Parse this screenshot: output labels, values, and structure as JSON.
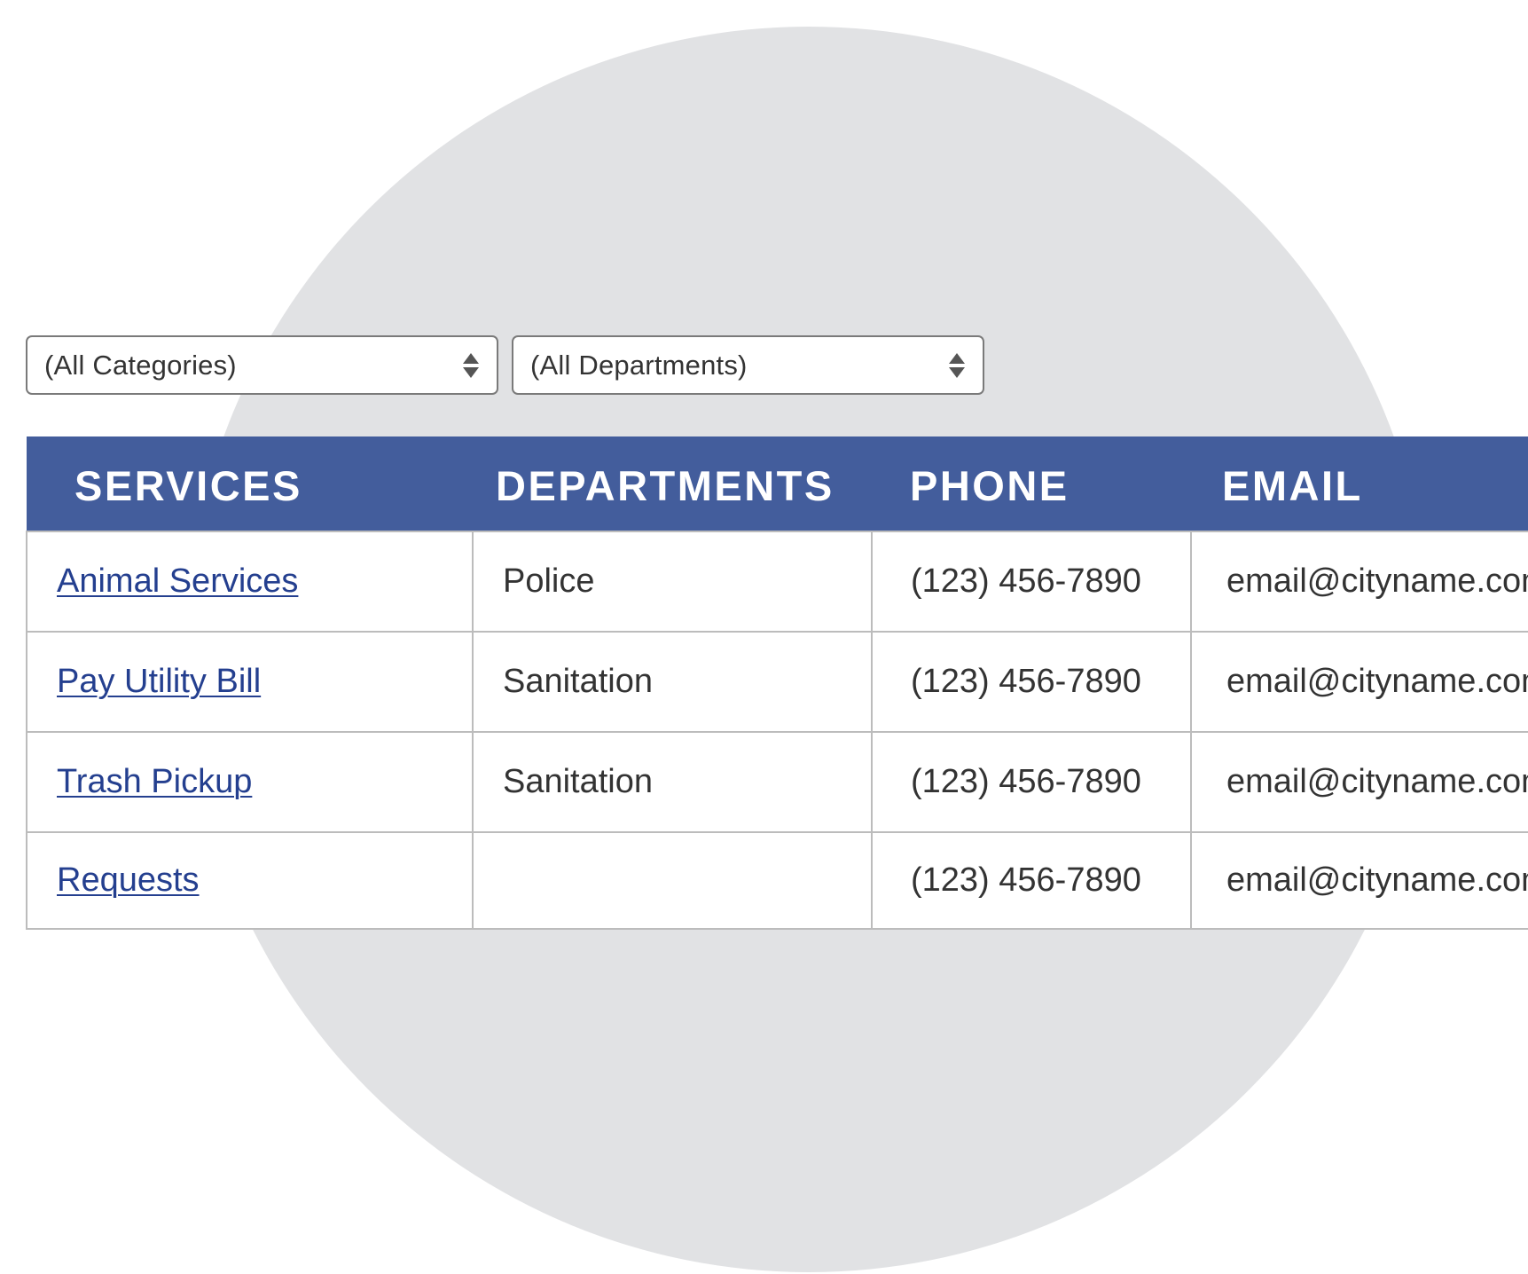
{
  "filters": {
    "category": {
      "selected": "(All Categories)"
    },
    "department": {
      "selected": "(All Departments)"
    }
  },
  "table": {
    "headers": {
      "services": "SERVICES",
      "departments": "DEPARTMENTS",
      "phone": "PHONE",
      "email": "EMAIL"
    },
    "rows": [
      {
        "service": "Animal Services",
        "department": "Police",
        "phone": "(123) 456-7890",
        "email": "email@cityname.com"
      },
      {
        "service": "Pay Utility Bill",
        "department": "Sanitation",
        "phone": "(123) 456-7890",
        "email": "email@cityname.com"
      },
      {
        "service": "Trash Pickup",
        "department": "Sanitation",
        "phone": "(123) 456-7890",
        "email": "email@cityname.com"
      },
      {
        "service": "Requests",
        "department": "",
        "phone": "(123) 456-7890",
        "email": "email@cityname.com"
      }
    ]
  },
  "colors": {
    "header_bg": "#435d9c",
    "link": "#243f8f",
    "circle_bg": "#e1e2e4",
    "border": "#bcbcbc"
  }
}
